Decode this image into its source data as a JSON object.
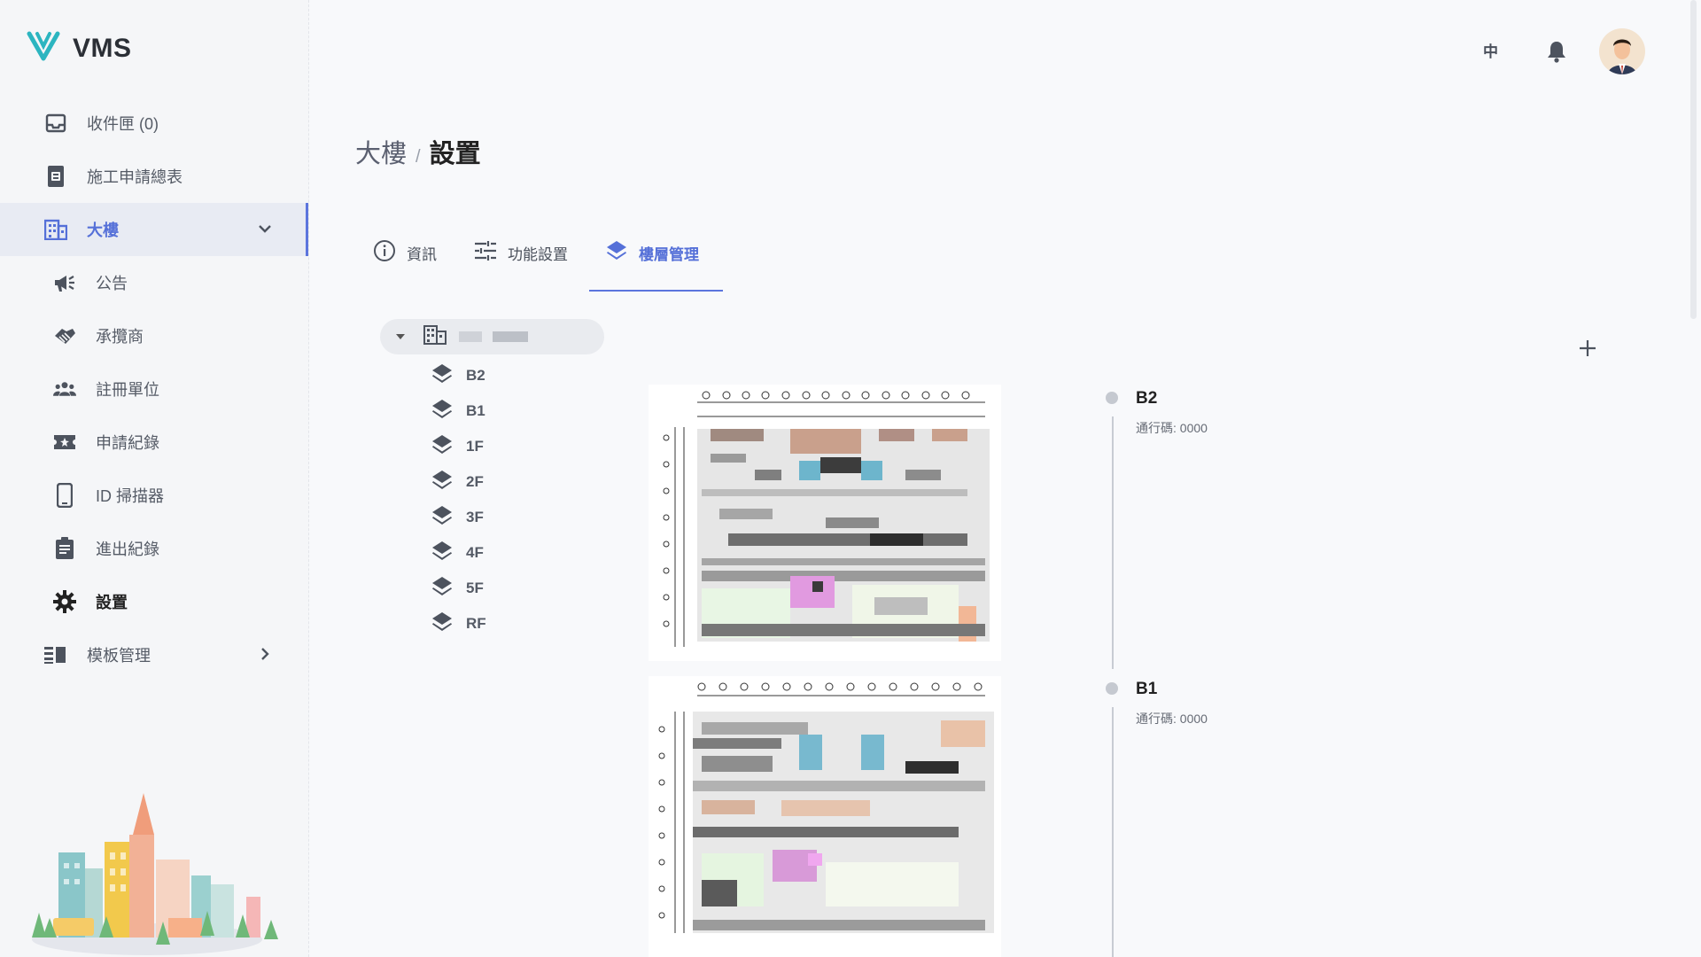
{
  "app": {
    "name": "VMS",
    "brand_color": "#2cb5c0",
    "accent": "#5c75dd"
  },
  "sidebar": {
    "items": [
      {
        "label": "收件匣 (0)",
        "icon": "inbox-icon"
      },
      {
        "label": "施工申請總表",
        "icon": "document-icon"
      },
      {
        "label": "大樓",
        "icon": "building-icon",
        "active": true,
        "expanded": true
      },
      {
        "label": "公告",
        "icon": "megaphone-icon",
        "sub": true
      },
      {
        "label": "承攬商",
        "icon": "handshake-icon",
        "sub": true
      },
      {
        "label": "註冊單位",
        "icon": "people-icon",
        "sub": true
      },
      {
        "label": "申請紀錄",
        "icon": "ticket-icon",
        "sub": true
      },
      {
        "label": "ID 掃描器",
        "icon": "phone-icon",
        "sub": true
      },
      {
        "label": "進出紀錄",
        "icon": "clipboard-icon",
        "sub": true
      },
      {
        "label": "設置",
        "icon": "gear-icon",
        "sub": true,
        "current": true
      },
      {
        "label": "模板管理",
        "icon": "template-icon",
        "expandable": true
      }
    ]
  },
  "topbar": {
    "lang_label": "中"
  },
  "breadcrumb": {
    "parent": "大樓",
    "separator": "/",
    "current": "設置"
  },
  "tabs": [
    {
      "label": "資訊",
      "icon": "info-icon"
    },
    {
      "label": "功能設置",
      "icon": "sliders-icon"
    },
    {
      "label": "樓層管理",
      "icon": "layers-icon",
      "active": true
    }
  ],
  "tree": {
    "floors": [
      "B2",
      "B1",
      "1F",
      "2F",
      "3F",
      "4F",
      "5F",
      "RF"
    ]
  },
  "floors_detail": [
    {
      "name": "B2",
      "code_label": "通行碼: 0000"
    },
    {
      "name": "B1",
      "code_label": "通行碼: 0000"
    }
  ]
}
